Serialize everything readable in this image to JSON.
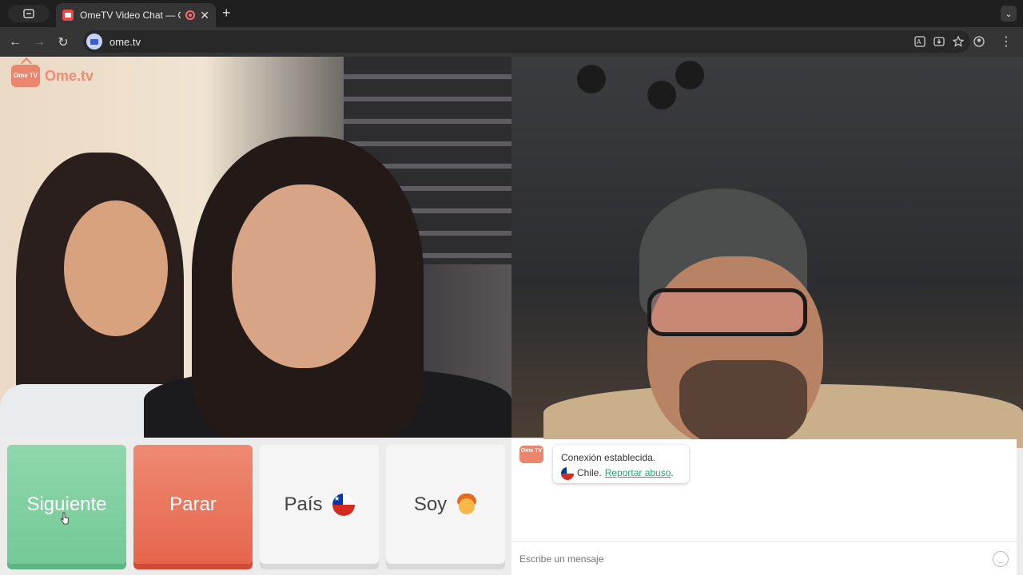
{
  "browser": {
    "tab_title": "OmeTV Video Chat — Ome",
    "tab_close": "✕",
    "new_tab": "+",
    "url": "ome.tv"
  },
  "logo": {
    "badge": "Ome TV",
    "text": "Ome.tv"
  },
  "buttons": {
    "next": "Siguiente",
    "stop": "Parar",
    "country": "País",
    "gender": "Soy"
  },
  "chat": {
    "logo_badge": "Ome TV",
    "message_line1": "Conexión establecida.",
    "country": "Chile.",
    "report_link": "Reportar abuso",
    "report_suffix": ".",
    "input_placeholder": "Escribe un mensaje"
  },
  "colors": {
    "next_green": "#74c996",
    "stop_red": "#e5654c",
    "brand_orange": "#f08b73",
    "link_green": "#2aa37a"
  }
}
